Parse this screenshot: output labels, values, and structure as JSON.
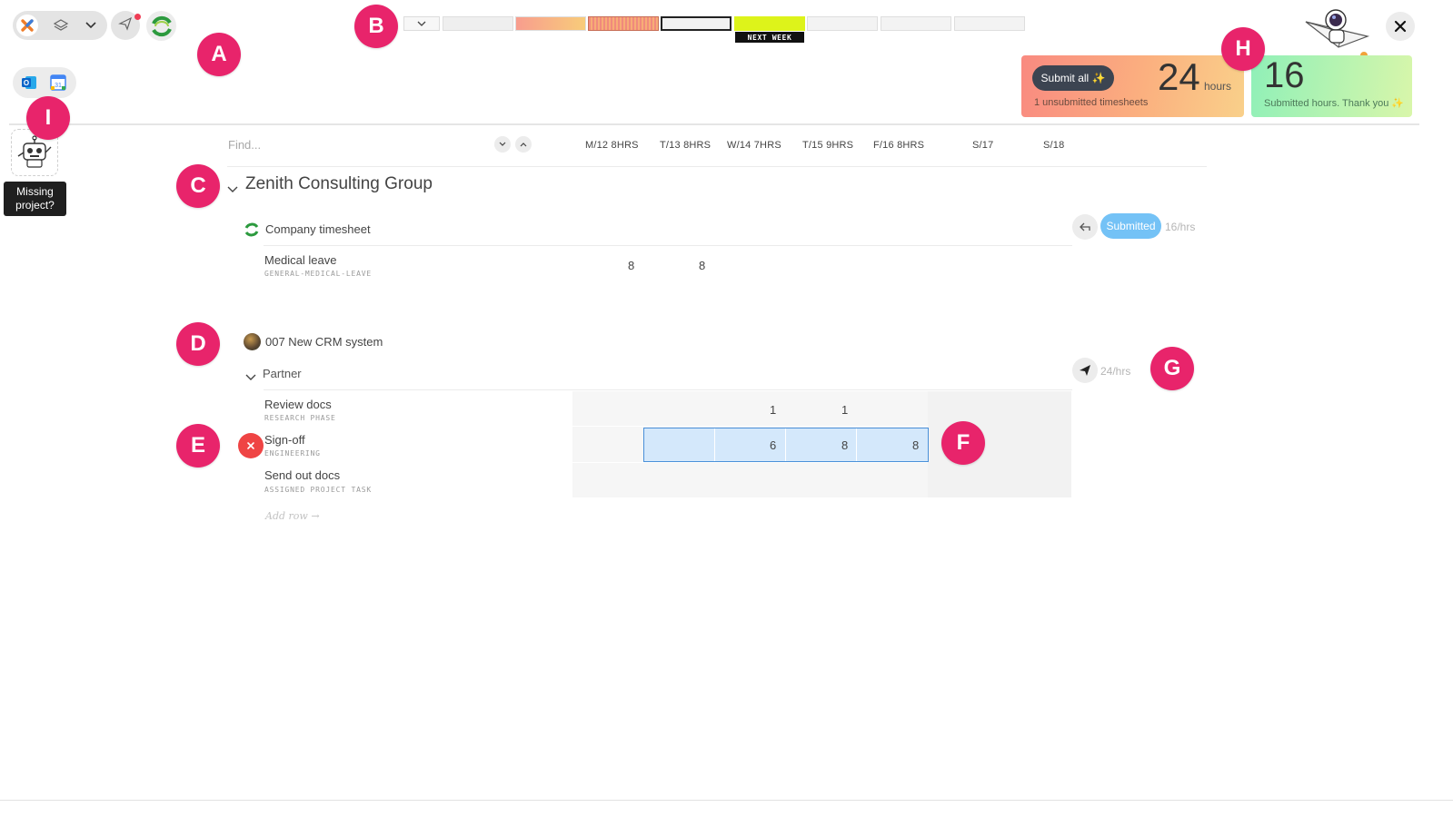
{
  "toolbar": {
    "icons": [
      "app-logo-icon",
      "layers-icon",
      "chevron-down-icon",
      "send-icon",
      "company-logo-icon"
    ],
    "integrations": [
      "outlook-icon",
      "google-calendar-icon"
    ]
  },
  "week_strip": {
    "label": "NEXT WEEK",
    "colors": [
      "#efefef",
      "#f8a58a",
      "#f08c7c",
      "#f3f3f3",
      "#ddf31a",
      "#f3f3f3",
      "#f3f3f3",
      "#f3f3f3"
    ]
  },
  "summary": {
    "submit_all_label": "Submit all ✨",
    "unsubmitted_hours": "24",
    "hours_unit": "hours",
    "unsubmitted_text": "1 unsubmitted timesheets",
    "submitted_hours": "16",
    "submitted_text": "Submitted hours. Thank you ✨"
  },
  "missing_project": {
    "line1": "Missing",
    "line2": "project?"
  },
  "grid": {
    "find_placeholder": "Find...",
    "columns": [
      "M/12 8HRS",
      "T/13 8HRS",
      "W/14 7HRS",
      "T/15 9HRS",
      "F/16 8HRS",
      "S/17",
      "S/18"
    ]
  },
  "client": {
    "name": "Zenith Consulting Group"
  },
  "company_timesheet": {
    "title": "Company timesheet",
    "status": "Submitted",
    "total": "16/hrs",
    "rows": [
      {
        "task": "Medical leave",
        "sub": "GENERAL-MEDICAL-LEAVE",
        "mon": "8",
        "tue": "8"
      }
    ]
  },
  "project": {
    "title": "007 New CRM system",
    "role": "Partner",
    "total": "24/hrs",
    "rows": [
      {
        "task": "Review docs",
        "sub": "RESEARCH PHASE",
        "wed": "1",
        "thu": "1"
      },
      {
        "task": "Sign-off",
        "sub": "ENGINEERING",
        "wed": "6",
        "thu": "8",
        "fri": "8"
      },
      {
        "task": "Send out docs",
        "sub": "ASSIGNED PROJECT TASK"
      }
    ],
    "add_row": "Add row →"
  },
  "markers": [
    "A",
    "B",
    "C",
    "D",
    "E",
    "F",
    "G",
    "H",
    "I"
  ],
  "colors": {
    "marker": "#e8246b",
    "submitted_badge": "#74c2f6",
    "selection": "#d4e8fb",
    "selection_border": "#4a90d9",
    "delete": "#ef4444"
  }
}
